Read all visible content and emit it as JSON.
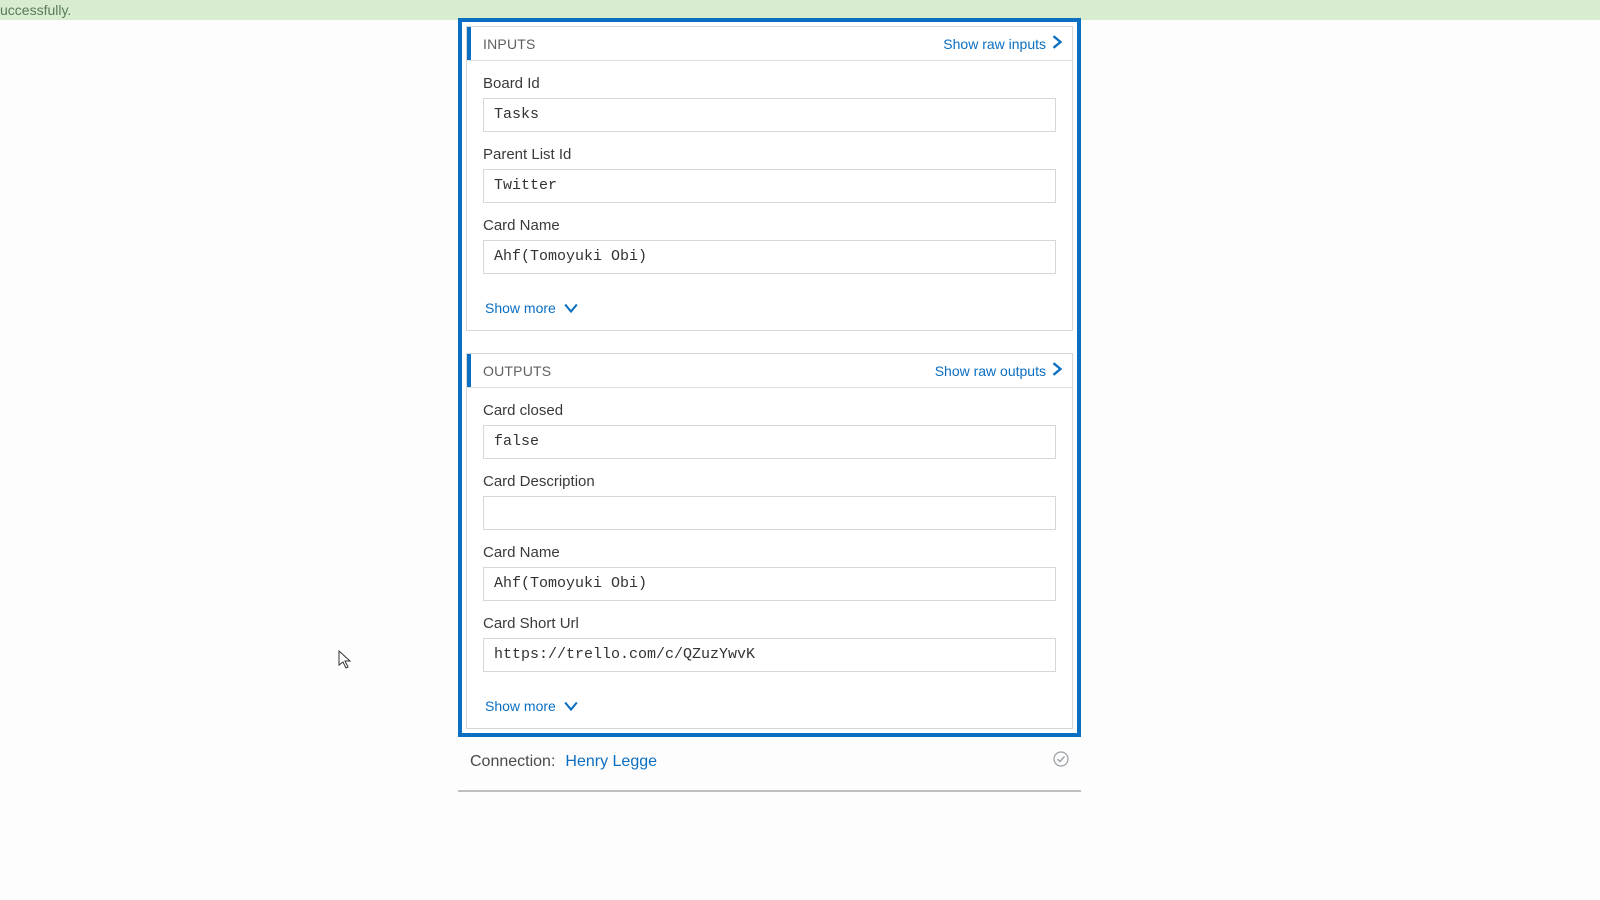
{
  "banner": {
    "text": "uccessfully."
  },
  "inputs": {
    "title": "INPUTS",
    "raw_link": "Show raw inputs",
    "fields": {
      "board_id": {
        "label": "Board Id",
        "value": "Tasks"
      },
      "parent_list": {
        "label": "Parent List Id",
        "value": "Twitter"
      },
      "card_name": {
        "label": "Card Name",
        "value": "Ahf(Tomoyuki Obi)"
      }
    },
    "show_more": "Show more"
  },
  "outputs": {
    "title": "OUTPUTS",
    "raw_link": "Show raw outputs",
    "fields": {
      "card_closed": {
        "label": "Card closed",
        "value": "false"
      },
      "card_desc": {
        "label": "Card Description",
        "value": ""
      },
      "card_name": {
        "label": "Card Name",
        "value": "Ahf(Tomoyuki Obi)"
      },
      "card_short_url": {
        "label": "Card Short Url",
        "value": "https://trello.com/c/QZuzYwvK"
      }
    },
    "show_more": "Show more"
  },
  "connection": {
    "label": "Connection:",
    "value": "Henry Legge"
  }
}
